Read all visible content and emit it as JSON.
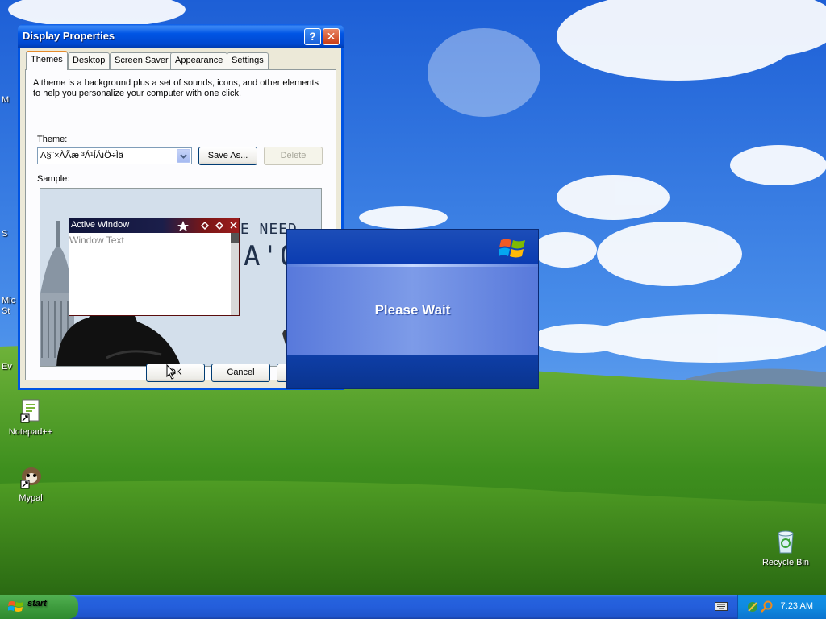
{
  "desktop": {
    "icons": [
      {
        "label": "Notepad++",
        "icon": "notepad-plus-plus-icon"
      },
      {
        "label": "Mypal",
        "icon": "mypal-browser-icon"
      },
      {
        "label": "Recycle Bin",
        "icon": "recycle-bin-icon"
      }
    ],
    "partial_labels": [
      "M",
      "S",
      "Mic",
      "St",
      "Ev"
    ]
  },
  "display_properties": {
    "title": "Display Properties",
    "help_glyph": "?",
    "close_glyph": "✕",
    "tabs": [
      {
        "label": "Themes",
        "active": true
      },
      {
        "label": "Desktop",
        "active": false
      },
      {
        "label": "Screen Saver",
        "active": false
      },
      {
        "label": "Appearance",
        "active": false
      },
      {
        "label": "Settings",
        "active": false
      }
    ],
    "description": "A theme is a background plus a set of sounds, icons, and other elements to help you personalize your computer with one click.",
    "theme_label": "Theme:",
    "theme_value": "A§¨×ÀÃæ ³Á¹ÍÁíÖ÷Ìâ",
    "save_as_label": "Save As...",
    "delete_label": "Delete",
    "sample_label": "Sample:",
    "sample": {
      "active_window_title": "Active Window",
      "window_text": "Window Text",
      "banner_line1": "VE NEED",
      "banner_line2": "A'O"
    },
    "ok_label": "OK",
    "cancel_label": "Cancel"
  },
  "please_wait": {
    "message": "Please Wait"
  },
  "taskbar": {
    "start_label": "start",
    "clock": "7:23 AM"
  },
  "colors": {
    "xp_blue": "#0054e3",
    "taskbar_blue": "#245edb",
    "start_green": "#3e9c3e",
    "tray_blue": "#0f8ae0",
    "dialog_face": "#ece9d8"
  }
}
